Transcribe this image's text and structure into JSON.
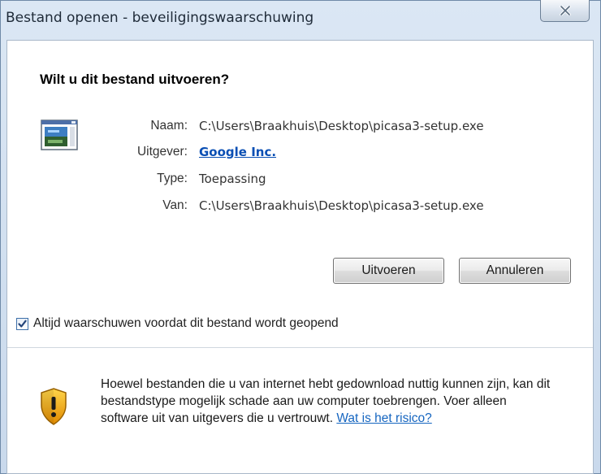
{
  "window": {
    "title": "Bestand openen - beveiligingswaarschuwing"
  },
  "dialog": {
    "question": "Wilt u dit bestand uitvoeren?",
    "details": [
      {
        "label": "Naam:",
        "value": "C:\\Users\\Braakhuis\\Desktop\\picasa3-setup.exe",
        "is_link": false
      },
      {
        "label": "Uitgever:",
        "value": "Google Inc.",
        "is_link": true
      },
      {
        "label": "Type:",
        "value": "Toepassing",
        "is_link": false
      },
      {
        "label": "Van:",
        "value": "C:\\Users\\Braakhuis\\Desktop\\picasa3-setup.exe",
        "is_link": false
      }
    ],
    "buttons": {
      "run_label": "Uitvoeren",
      "cancel_label": "Annuleren"
    },
    "checkbox": {
      "label": "Altijd waarschuwen voordat dit bestand wordt geopend",
      "checked": true
    },
    "warning": {
      "text": "Hoewel bestanden die u van internet hebt gedownload nuttig kunnen zijn, kan dit bestandstype mogelijk schade aan uw computer toebrengen. Voer alleen software uit van uitgevers die u vertrouwt.",
      "link_label": "Wat is het risico?"
    }
  },
  "icons": {
    "close": "close-icon",
    "application": "application-icon",
    "shield": "shield-warning-icon",
    "check": "checkmark-icon"
  },
  "colors": {
    "link": "#0a4fb4",
    "frame": "#c9d9ec",
    "shield": "#f2a900"
  }
}
